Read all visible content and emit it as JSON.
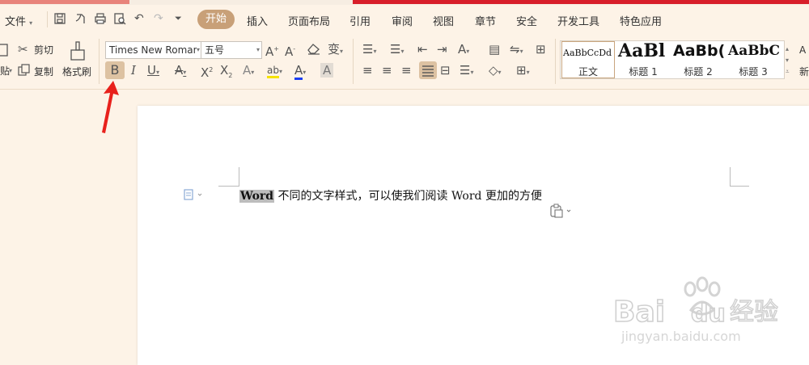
{
  "menu": {
    "file": "文件",
    "tabs": [
      "开始",
      "插入",
      "页面布局",
      "引用",
      "审阅",
      "视图",
      "章节",
      "安全",
      "开发工具",
      "特色应用"
    ]
  },
  "ribbon": {
    "paste_partial": "贴",
    "cut": "剪切",
    "copy": "复制",
    "format_painter": "格式刷",
    "font_name": "Times New Roman",
    "font_size": "五号",
    "styles": {
      "normal_sample": "AaBbCcDd",
      "h1_sample": "AaBl",
      "h2_sample": "AaBb(",
      "h3_sample": "AaBbC",
      "normal_label": "正文",
      "h1_label": "标题 1",
      "h2_label": "标题 2",
      "h3_label": "标题 3",
      "new_partial": "新"
    }
  },
  "document": {
    "selected_word": "Word",
    "line_rest": " 不同的文字样式，可以使我们阅读 Word 更加的方便"
  },
  "watermark": {
    "brand": "Bai",
    "brand2": "du",
    "cn": "经验",
    "url": "jingyan.baidu.com"
  },
  "colors": {
    "accent": "#c8a078",
    "arrow": "#e8211c",
    "font_color_bar": "#1b3df2",
    "highlight_bar": "#f5e200"
  }
}
